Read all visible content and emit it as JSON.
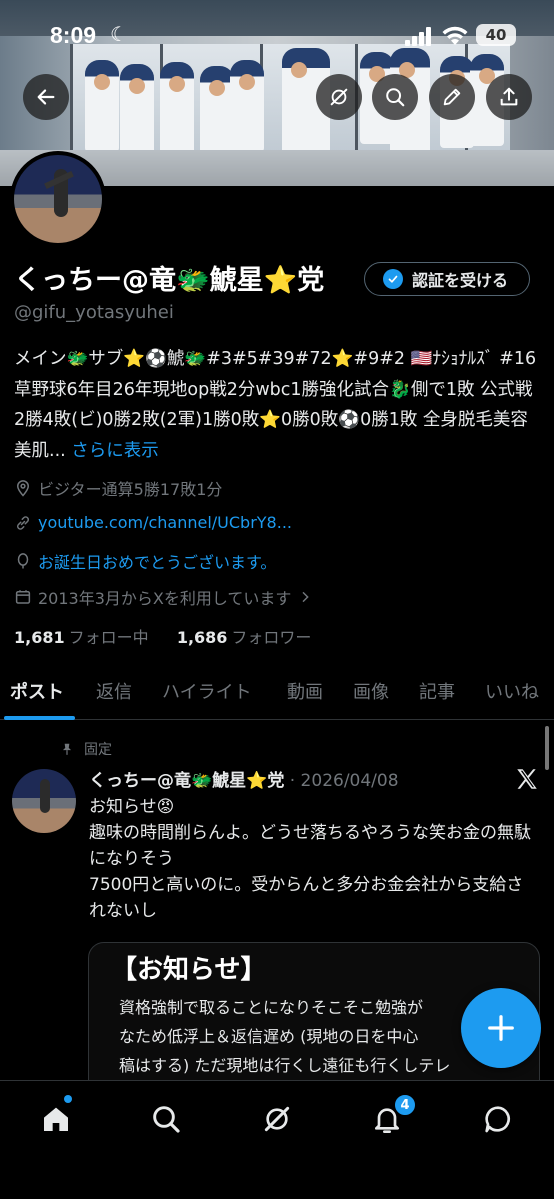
{
  "status_bar": {
    "time": "8:09",
    "battery": "40"
  },
  "profile": {
    "display_name": "くっちー@竜🐲鯱星⭐党",
    "handle": "@gifu_yotasyuhei",
    "verify_button": "認証を受ける",
    "bio": "メイン🐲サブ⭐⚽鯱🐲#3#5#39#72⭐#9#2 🇺🇸ﾅｼｮﾅﾙｽﾞ #16 草野球6年目26年現地op戦2分wbc1勝強化試合🐉側で1敗 公式戦2勝4敗(ビ)0勝2敗(2軍)1勝0敗⭐0勝0敗⚽0勝1敗 全身脱毛美容美肌...",
    "bio_more": "さらに表示",
    "location": "ビジター通算5勝17敗1分",
    "website": "youtube.com/channel/UCbrY8...",
    "birthday": "お誕生日おめでとうございます。",
    "joined": "2013年3月からXを利用しています",
    "following_count": "1,681",
    "following_label": "フォロー中",
    "followers_count": "1,686",
    "followers_label": "フォロワー"
  },
  "tabs": [
    {
      "label": "ポスト"
    },
    {
      "label": "返信"
    },
    {
      "label": "ハイライト"
    },
    {
      "label": "動画"
    },
    {
      "label": "画像"
    },
    {
      "label": "記事"
    },
    {
      "label": "いいね"
    }
  ],
  "pinned_post": {
    "pinned_label": "固定",
    "author": "くっちー@竜🐲鯱星⭐党",
    "date": "· 2026/04/08",
    "text": "お知らせ😡\n趣味の時間削らんよ。どうせ落ちるやろうな笑お金の無駄になりそう\n7500円と高いのに。受からんと多分お金会社から支給されないし",
    "card_title": "【お知らせ】",
    "card_text": "資格強制で取ることになりそこそこ勉強が\nなため低浮上＆返信遅め (現地の日を中心\n稿はする) ただ現地は行くし遠征も行くしテレ"
  },
  "bottom_nav": {
    "notification_count": "4"
  },
  "colors": {
    "accent": "#1d9bf0",
    "background": "#000000",
    "muted": "#71767b"
  }
}
